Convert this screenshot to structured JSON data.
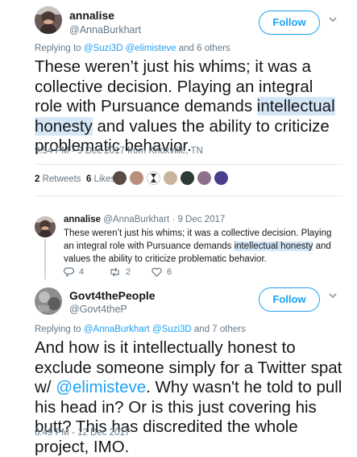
{
  "tweet1": {
    "name": "annalise",
    "handle": "@AnnaBurkhart",
    "follow": "Follow",
    "reply_prefix": "Replying to",
    "reply_mention1": "@Suzi3D",
    "reply_mention2": "@elimisteve",
    "reply_suffix": "and 6 others",
    "text_a": "These weren’t just his whims; it was a collective decision. Playing an integral role with Pursuance demands ",
    "text_hl": "intellectual honesty",
    "text_b": " and values the ability to criticize problematic behavior.",
    "timestamp": "9:54 PM - 9 Dec 2017 from Knoxville, TN",
    "retweets_count": "2",
    "retweets_label": "Retweets",
    "likes_count": "6",
    "likes_label": "Likes"
  },
  "quoted": {
    "name": "annalise",
    "handle_date": "@AnnaBurkhart · 9 Dec 2017",
    "text_a": "These weren’t just his whims; it was a collective decision. Playing an integral role with Pursuance demands ",
    "text_hl": "intellectual honesty",
    "text_b": " and values the ability to criticize problematic behavior.",
    "replies": "4",
    "retweets": "2",
    "likes": "6"
  },
  "tweet2": {
    "name": "Govt4thePeople",
    "handle": "@Govt4theP",
    "follow": "Follow",
    "reply_prefix": "Replying to",
    "reply_mention1": "@AnnaBurkhart",
    "reply_mention2": "@Suzi3D",
    "reply_suffix": "and 7 others",
    "text_a": "And how is it intellectually honest to exclude someone simply for a Twitter spat w/ ",
    "text_mention": "@elimisteve",
    "text_b": ". Why wasn't he told to pull his head in?  Or is this just covering his butt? This has discredited the whole project, IMO.",
    "timestamp": "6:49 PM - 12 Dec 2017"
  },
  "colors": {
    "accent": "#1da1f2",
    "highlight": "#d5e7f7",
    "muted": "#657786"
  }
}
